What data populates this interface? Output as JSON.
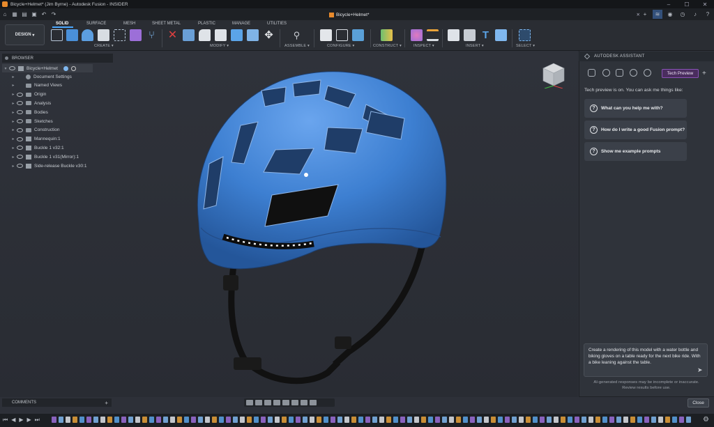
{
  "window": {
    "title": "Bicycle+Helmet* (Jim Byrne) - Autodesk Fusion - INSIDER"
  },
  "document_tab": {
    "label": "Bicycle+Helmet*"
  },
  "toolbar": {
    "workspace": "DESIGN",
    "tabs": [
      "SOLID",
      "SURFACE",
      "MESH",
      "SHEET METAL",
      "PLASTIC",
      "MANAGE",
      "UTILITIES"
    ],
    "active_tab": "SOLID",
    "groups": [
      "CREATE",
      "MODIFY",
      "ASSEMBLE",
      "CONFIGURE",
      "CONSTRUCT",
      "INSPECT",
      "INSERT",
      "SELECT"
    ]
  },
  "browser": {
    "title": "BROWSER",
    "root": "Bicycle+Helmet",
    "items": [
      {
        "label": "Document Settings",
        "icon": "gear-icon"
      },
      {
        "label": "Named Views",
        "icon": "folder-icon"
      },
      {
        "label": "Origin",
        "icon": "folder-icon"
      },
      {
        "label": "Analysis",
        "icon": "folder-icon"
      },
      {
        "label": "Bodies",
        "icon": "folder-icon"
      },
      {
        "label": "Sketches",
        "icon": "folder-icon"
      },
      {
        "label": "Construction",
        "icon": "folder-icon"
      },
      {
        "label": "Mannequin:1",
        "icon": "component-icon"
      },
      {
        "label": "Buckle 1 v32:1",
        "icon": "component-icon"
      },
      {
        "label": "Buckle 1 v31(Mirror):1",
        "icon": "component-icon"
      },
      {
        "label": "Side-release Buckle v30:1",
        "icon": "component-icon"
      }
    ]
  },
  "comments": {
    "title": "COMMENTS"
  },
  "assistant": {
    "title": "AUTODESK ASSISTANT",
    "badge": "Tech Preview",
    "intro": "Tech preview is on. You can ask me things like:",
    "prompts": [
      "What can you help me with?",
      "How do I write a good Fusion prompt?",
      "Show me example prompts"
    ],
    "input_text": "Create a rendering of this model with a water bottle and biking gloves on a table ready for the next bike ride.  With a bike leaning against the table.",
    "disclaimer_line1": "AI-generated responses may be incomplete or inaccurate.",
    "disclaimer_line2": "Review results before use.",
    "close_label": "Close"
  },
  "colors": {
    "accent": "#4aa8ff",
    "helmet": "#3d7fd1",
    "tech_preview": "#8a52b6",
    "brand": "#e88a2c"
  }
}
